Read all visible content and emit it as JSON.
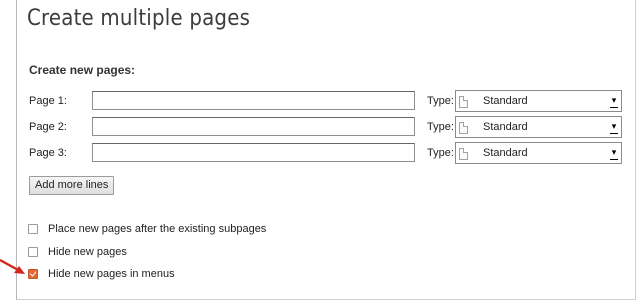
{
  "page": {
    "title": "Create multiple pages",
    "section_heading": "Create new pages:"
  },
  "rows": [
    {
      "label": "Page 1:",
      "value": "",
      "type_label": "Type:",
      "type_value": "Standard"
    },
    {
      "label": "Page 2:",
      "value": "",
      "type_label": "Type:",
      "type_value": "Standard"
    },
    {
      "label": "Page 3:",
      "value": "",
      "type_label": "Type:",
      "type_value": "Standard"
    }
  ],
  "add_more_label": "Add more lines",
  "options": [
    {
      "label": "Place new pages after the existing subpages",
      "checked": false
    },
    {
      "label": "Hide new pages",
      "checked": false
    },
    {
      "label": "Hide new pages in menus",
      "checked": true
    }
  ],
  "colors": {
    "checked_accent": "#e3672f",
    "pointer_arrow": "#d0261c"
  },
  "icons": {
    "type_icon": "page-document-icon",
    "dropdown": "dropdown-arrow-icon",
    "pointer": "red-arrow-pointer"
  }
}
